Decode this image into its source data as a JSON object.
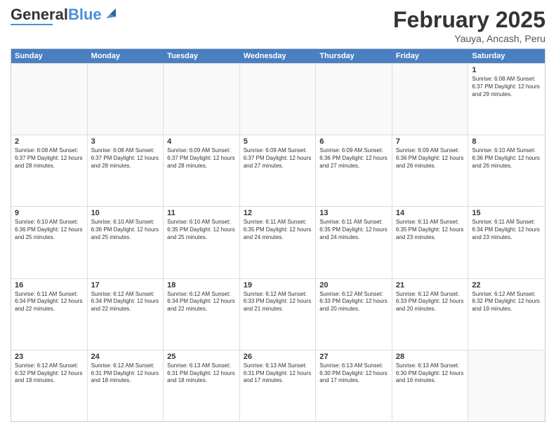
{
  "header": {
    "logo_general": "General",
    "logo_blue": "Blue",
    "month_title": "February 2025",
    "location": "Yauya, Ancash, Peru"
  },
  "days_of_week": [
    "Sunday",
    "Monday",
    "Tuesday",
    "Wednesday",
    "Thursday",
    "Friday",
    "Saturday"
  ],
  "weeks": [
    [
      {
        "day": "",
        "text": ""
      },
      {
        "day": "",
        "text": ""
      },
      {
        "day": "",
        "text": ""
      },
      {
        "day": "",
        "text": ""
      },
      {
        "day": "",
        "text": ""
      },
      {
        "day": "",
        "text": ""
      },
      {
        "day": "1",
        "text": "Sunrise: 6:08 AM\nSunset: 6:37 PM\nDaylight: 12 hours and 29 minutes."
      }
    ],
    [
      {
        "day": "2",
        "text": "Sunrise: 6:08 AM\nSunset: 6:37 PM\nDaylight: 12 hours and 28 minutes."
      },
      {
        "day": "3",
        "text": "Sunrise: 6:08 AM\nSunset: 6:37 PM\nDaylight: 12 hours and 28 minutes."
      },
      {
        "day": "4",
        "text": "Sunrise: 6:09 AM\nSunset: 6:37 PM\nDaylight: 12 hours and 28 minutes."
      },
      {
        "day": "5",
        "text": "Sunrise: 6:09 AM\nSunset: 6:37 PM\nDaylight: 12 hours and 27 minutes."
      },
      {
        "day": "6",
        "text": "Sunrise: 6:09 AM\nSunset: 6:36 PM\nDaylight: 12 hours and 27 minutes."
      },
      {
        "day": "7",
        "text": "Sunrise: 6:09 AM\nSunset: 6:36 PM\nDaylight: 12 hours and 26 minutes."
      },
      {
        "day": "8",
        "text": "Sunrise: 6:10 AM\nSunset: 6:36 PM\nDaylight: 12 hours and 26 minutes."
      }
    ],
    [
      {
        "day": "9",
        "text": "Sunrise: 6:10 AM\nSunset: 6:36 PM\nDaylight: 12 hours and 25 minutes."
      },
      {
        "day": "10",
        "text": "Sunrise: 6:10 AM\nSunset: 6:36 PM\nDaylight: 12 hours and 25 minutes."
      },
      {
        "day": "11",
        "text": "Sunrise: 6:10 AM\nSunset: 6:35 PM\nDaylight: 12 hours and 25 minutes."
      },
      {
        "day": "12",
        "text": "Sunrise: 6:11 AM\nSunset: 6:35 PM\nDaylight: 12 hours and 24 minutes."
      },
      {
        "day": "13",
        "text": "Sunrise: 6:11 AM\nSunset: 6:35 PM\nDaylight: 12 hours and 24 minutes."
      },
      {
        "day": "14",
        "text": "Sunrise: 6:11 AM\nSunset: 6:35 PM\nDaylight: 12 hours and 23 minutes."
      },
      {
        "day": "15",
        "text": "Sunrise: 6:11 AM\nSunset: 6:34 PM\nDaylight: 12 hours and 23 minutes."
      }
    ],
    [
      {
        "day": "16",
        "text": "Sunrise: 6:11 AM\nSunset: 6:34 PM\nDaylight: 12 hours and 22 minutes."
      },
      {
        "day": "17",
        "text": "Sunrise: 6:12 AM\nSunset: 6:34 PM\nDaylight: 12 hours and 22 minutes."
      },
      {
        "day": "18",
        "text": "Sunrise: 6:12 AM\nSunset: 6:34 PM\nDaylight: 12 hours and 22 minutes."
      },
      {
        "day": "19",
        "text": "Sunrise: 6:12 AM\nSunset: 6:33 PM\nDaylight: 12 hours and 21 minutes."
      },
      {
        "day": "20",
        "text": "Sunrise: 6:12 AM\nSunset: 6:33 PM\nDaylight: 12 hours and 20 minutes."
      },
      {
        "day": "21",
        "text": "Sunrise: 6:12 AM\nSunset: 6:33 PM\nDaylight: 12 hours and 20 minutes."
      },
      {
        "day": "22",
        "text": "Sunrise: 6:12 AM\nSunset: 6:32 PM\nDaylight: 12 hours and 19 minutes."
      }
    ],
    [
      {
        "day": "23",
        "text": "Sunrise: 6:12 AM\nSunset: 6:32 PM\nDaylight: 12 hours and 19 minutes."
      },
      {
        "day": "24",
        "text": "Sunrise: 6:12 AM\nSunset: 6:31 PM\nDaylight: 12 hours and 18 minutes."
      },
      {
        "day": "25",
        "text": "Sunrise: 6:13 AM\nSunset: 6:31 PM\nDaylight: 12 hours and 18 minutes."
      },
      {
        "day": "26",
        "text": "Sunrise: 6:13 AM\nSunset: 6:31 PM\nDaylight: 12 hours and 17 minutes."
      },
      {
        "day": "27",
        "text": "Sunrise: 6:13 AM\nSunset: 6:30 PM\nDaylight: 12 hours and 17 minutes."
      },
      {
        "day": "28",
        "text": "Sunrise: 6:13 AM\nSunset: 6:30 PM\nDaylight: 12 hours and 16 minutes."
      },
      {
        "day": "",
        "text": ""
      }
    ]
  ]
}
